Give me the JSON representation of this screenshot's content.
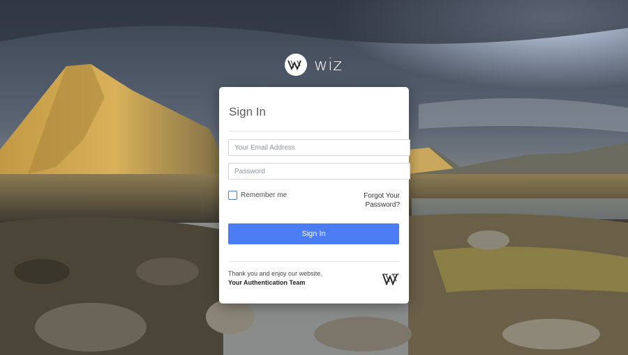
{
  "brand": {
    "name": "wiz",
    "logo_icon": "wiz-w-logo"
  },
  "login": {
    "title": "Sign In",
    "email_placeholder": "Your Email Address",
    "password_placeholder": "Password",
    "remember_label": "Remember me",
    "forgot_label": "Forgot Your Password?",
    "submit_label": "Sign In"
  },
  "footer": {
    "message": "Thank you and enjoy our website.",
    "team": "Your Authentication Team"
  },
  "colors": {
    "accent": "#4b7cf3",
    "card_bg": "#ffffff",
    "checkbox_border": "#4a7bd9"
  }
}
